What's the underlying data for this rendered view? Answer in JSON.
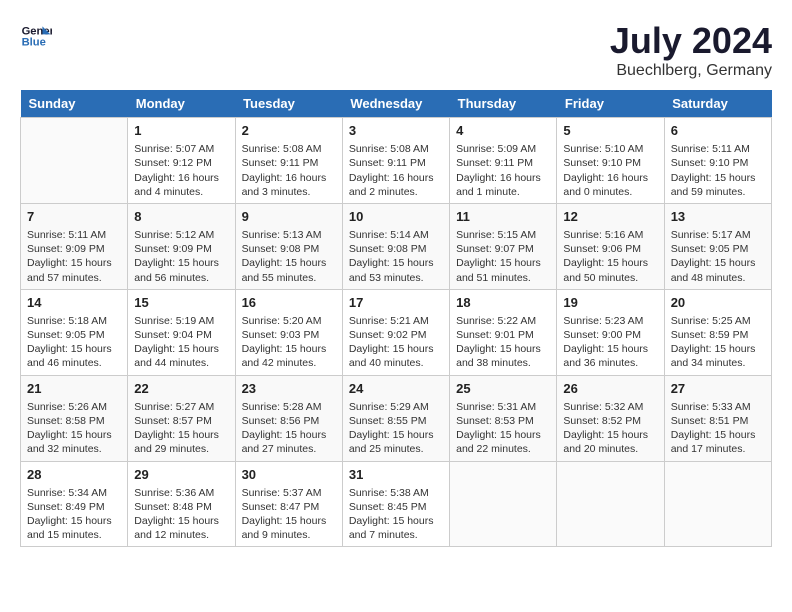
{
  "header": {
    "logo_line1": "General",
    "logo_line2": "Blue",
    "month_year": "July 2024",
    "location": "Buechlberg, Germany"
  },
  "weekdays": [
    "Sunday",
    "Monday",
    "Tuesday",
    "Wednesday",
    "Thursday",
    "Friday",
    "Saturday"
  ],
  "weeks": [
    [
      {
        "day": "",
        "info": ""
      },
      {
        "day": "1",
        "info": "Sunrise: 5:07 AM\nSunset: 9:12 PM\nDaylight: 16 hours\nand 4 minutes."
      },
      {
        "day": "2",
        "info": "Sunrise: 5:08 AM\nSunset: 9:11 PM\nDaylight: 16 hours\nand 3 minutes."
      },
      {
        "day": "3",
        "info": "Sunrise: 5:08 AM\nSunset: 9:11 PM\nDaylight: 16 hours\nand 2 minutes."
      },
      {
        "day": "4",
        "info": "Sunrise: 5:09 AM\nSunset: 9:11 PM\nDaylight: 16 hours\nand 1 minute."
      },
      {
        "day": "5",
        "info": "Sunrise: 5:10 AM\nSunset: 9:10 PM\nDaylight: 16 hours\nand 0 minutes."
      },
      {
        "day": "6",
        "info": "Sunrise: 5:11 AM\nSunset: 9:10 PM\nDaylight: 15 hours\nand 59 minutes."
      }
    ],
    [
      {
        "day": "7",
        "info": "Sunrise: 5:11 AM\nSunset: 9:09 PM\nDaylight: 15 hours\nand 57 minutes."
      },
      {
        "day": "8",
        "info": "Sunrise: 5:12 AM\nSunset: 9:09 PM\nDaylight: 15 hours\nand 56 minutes."
      },
      {
        "day": "9",
        "info": "Sunrise: 5:13 AM\nSunset: 9:08 PM\nDaylight: 15 hours\nand 55 minutes."
      },
      {
        "day": "10",
        "info": "Sunrise: 5:14 AM\nSunset: 9:08 PM\nDaylight: 15 hours\nand 53 minutes."
      },
      {
        "day": "11",
        "info": "Sunrise: 5:15 AM\nSunset: 9:07 PM\nDaylight: 15 hours\nand 51 minutes."
      },
      {
        "day": "12",
        "info": "Sunrise: 5:16 AM\nSunset: 9:06 PM\nDaylight: 15 hours\nand 50 minutes."
      },
      {
        "day": "13",
        "info": "Sunrise: 5:17 AM\nSunset: 9:05 PM\nDaylight: 15 hours\nand 48 minutes."
      }
    ],
    [
      {
        "day": "14",
        "info": "Sunrise: 5:18 AM\nSunset: 9:05 PM\nDaylight: 15 hours\nand 46 minutes."
      },
      {
        "day": "15",
        "info": "Sunrise: 5:19 AM\nSunset: 9:04 PM\nDaylight: 15 hours\nand 44 minutes."
      },
      {
        "day": "16",
        "info": "Sunrise: 5:20 AM\nSunset: 9:03 PM\nDaylight: 15 hours\nand 42 minutes."
      },
      {
        "day": "17",
        "info": "Sunrise: 5:21 AM\nSunset: 9:02 PM\nDaylight: 15 hours\nand 40 minutes."
      },
      {
        "day": "18",
        "info": "Sunrise: 5:22 AM\nSunset: 9:01 PM\nDaylight: 15 hours\nand 38 minutes."
      },
      {
        "day": "19",
        "info": "Sunrise: 5:23 AM\nSunset: 9:00 PM\nDaylight: 15 hours\nand 36 minutes."
      },
      {
        "day": "20",
        "info": "Sunrise: 5:25 AM\nSunset: 8:59 PM\nDaylight: 15 hours\nand 34 minutes."
      }
    ],
    [
      {
        "day": "21",
        "info": "Sunrise: 5:26 AM\nSunset: 8:58 PM\nDaylight: 15 hours\nand 32 minutes."
      },
      {
        "day": "22",
        "info": "Sunrise: 5:27 AM\nSunset: 8:57 PM\nDaylight: 15 hours\nand 29 minutes."
      },
      {
        "day": "23",
        "info": "Sunrise: 5:28 AM\nSunset: 8:56 PM\nDaylight: 15 hours\nand 27 minutes."
      },
      {
        "day": "24",
        "info": "Sunrise: 5:29 AM\nSunset: 8:55 PM\nDaylight: 15 hours\nand 25 minutes."
      },
      {
        "day": "25",
        "info": "Sunrise: 5:31 AM\nSunset: 8:53 PM\nDaylight: 15 hours\nand 22 minutes."
      },
      {
        "day": "26",
        "info": "Sunrise: 5:32 AM\nSunset: 8:52 PM\nDaylight: 15 hours\nand 20 minutes."
      },
      {
        "day": "27",
        "info": "Sunrise: 5:33 AM\nSunset: 8:51 PM\nDaylight: 15 hours\nand 17 minutes."
      }
    ],
    [
      {
        "day": "28",
        "info": "Sunrise: 5:34 AM\nSunset: 8:49 PM\nDaylight: 15 hours\nand 15 minutes."
      },
      {
        "day": "29",
        "info": "Sunrise: 5:36 AM\nSunset: 8:48 PM\nDaylight: 15 hours\nand 12 minutes."
      },
      {
        "day": "30",
        "info": "Sunrise: 5:37 AM\nSunset: 8:47 PM\nDaylight: 15 hours\nand 9 minutes."
      },
      {
        "day": "31",
        "info": "Sunrise: 5:38 AM\nSunset: 8:45 PM\nDaylight: 15 hours\nand 7 minutes."
      },
      {
        "day": "",
        "info": ""
      },
      {
        "day": "",
        "info": ""
      },
      {
        "day": "",
        "info": ""
      }
    ]
  ]
}
